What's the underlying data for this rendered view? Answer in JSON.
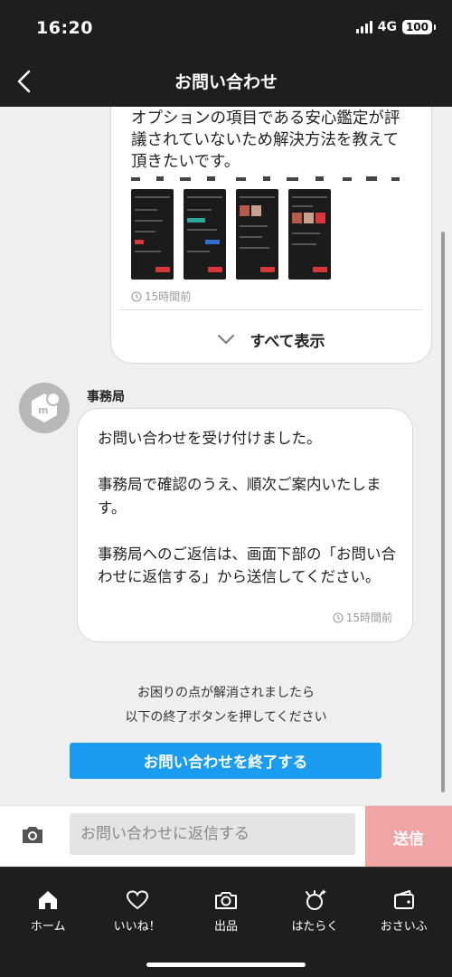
{
  "status_bar": {
    "time": "16:20",
    "network": "4G",
    "battery": "100"
  },
  "header": {
    "title": "お問い合わせ"
  },
  "user_message": {
    "lines": [
      "オプションの項目である安心鑑定が評",
      "議されていないため解決方法を教えて",
      "頂きたいです。"
    ],
    "time": "15時間前",
    "show_all_label": "すべて表示"
  },
  "admin_message": {
    "sender": "事務局",
    "paragraphs": [
      "お問い合わせを受け付けました。",
      "事務局で確認のうえ、順次ご案内いたします。",
      "事務局へのご返信は、画面下部の「お問い合わせに返信する」から送信してください。"
    ],
    "time": "15時間前"
  },
  "resolve": {
    "note_line1": "お困りの点が解消されましたら",
    "note_line2": "以下の終了ボタンを押してください",
    "end_button": "お問い合わせを終了する"
  },
  "composer": {
    "placeholder": "お問い合わせに返信する",
    "send_label": "送信"
  },
  "tabs": [
    {
      "label": "ホーム",
      "icon": "home-icon"
    },
    {
      "label": "いいね！",
      "icon": "heart-icon"
    },
    {
      "label": "出品",
      "icon": "camera-icon"
    },
    {
      "label": "はたらく",
      "icon": "work-icon"
    },
    {
      "label": "おさいふ",
      "icon": "wallet-icon"
    }
  ],
  "colors": {
    "accent_blue": "#1a9df0",
    "send_pink": "#f0a4a4",
    "dark_bar": "#1e1e1e"
  }
}
